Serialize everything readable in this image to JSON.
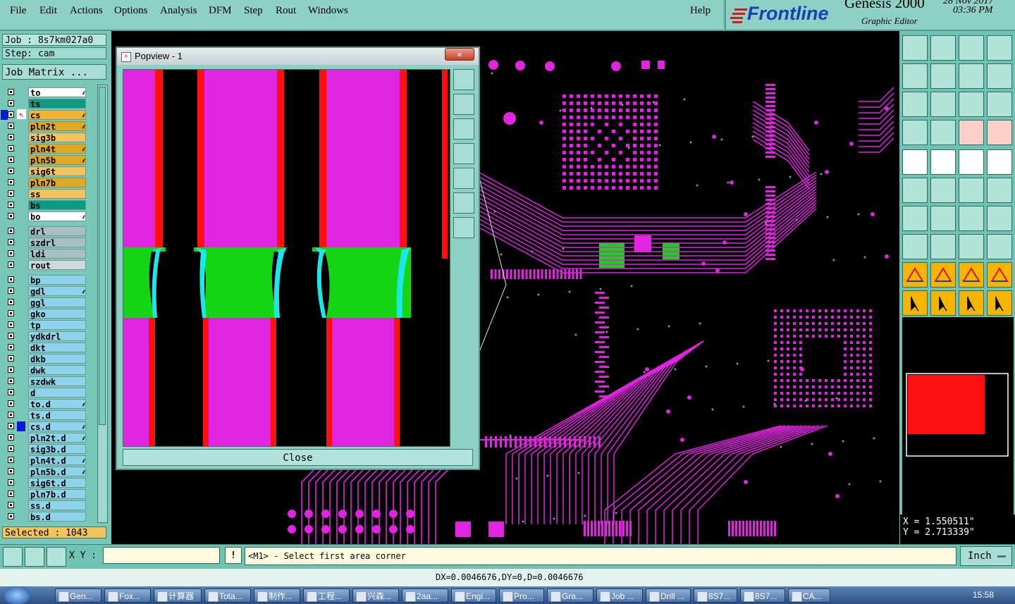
{
  "menubar": {
    "items": [
      "File",
      "Edit",
      "Actions",
      "Options",
      "Analysis",
      "DFM",
      "Step",
      "Rout",
      "Windows"
    ],
    "help": "Help"
  },
  "brand": {
    "logo": "Frontline",
    "product": "Genesis 2000",
    "subtitle": "Graphic Editor",
    "date": "28 Nov 2017",
    "time": "03:36 PM"
  },
  "job": {
    "job_label": "Job : 8s7km027a0",
    "step_label": "Step: cam",
    "matrix_button": "Job Matrix ...",
    "selected": "Selected : 1043"
  },
  "layers": [
    {
      "name": "to",
      "color": "#ffffff",
      "mark": "⸙"
    },
    {
      "name": "ts",
      "color": "#0f9a86",
      "mark": ""
    },
    {
      "name": "cs",
      "color": "#f2b233",
      "mark": "⸙"
    },
    {
      "name": "pln2t",
      "color": "#e3a81e",
      "mark": "⸙"
    },
    {
      "name": "sig3b",
      "color": "#f5c35d",
      "mark": ""
    },
    {
      "name": "pln4t",
      "color": "#e3a81e",
      "mark": "⸙"
    },
    {
      "name": "pln5b",
      "color": "#e3a81e",
      "mark": "⸙"
    },
    {
      "name": "sig6t",
      "color": "#f5c35d",
      "mark": ""
    },
    {
      "name": "pln7b",
      "color": "#e3a81e",
      "mark": ""
    },
    {
      "name": "ss",
      "color": "#f5c35d",
      "mark": ""
    },
    {
      "name": "bs",
      "color": "#0f9a86",
      "mark": ""
    },
    {
      "name": "bo",
      "color": "#ffffff",
      "mark": "⸙"
    },
    {
      "name": "drl",
      "color": "#a8bfc3",
      "mark": ""
    },
    {
      "name": "szdrl",
      "color": "#a8bfc3",
      "mark": ""
    },
    {
      "name": "ldi",
      "color": "#a8bfc3",
      "mark": ""
    },
    {
      "name": "rout",
      "color": "#cfd7d9",
      "mark": ""
    },
    {
      "name": "bp",
      "color": "#8fd3ea",
      "mark": ""
    },
    {
      "name": "gdl",
      "color": "#8fd3ea",
      "mark": "⸙"
    },
    {
      "name": "ggl",
      "color": "#8fd3ea",
      "mark": ""
    },
    {
      "name": "gko",
      "color": "#8fd3ea",
      "mark": ""
    },
    {
      "name": "tp",
      "color": "#8fd3ea",
      "mark": ""
    },
    {
      "name": "ydkdrl",
      "color": "#8fd3ea",
      "mark": ""
    },
    {
      "name": "dkt",
      "color": "#8fd3ea",
      "mark": ""
    },
    {
      "name": "dkb",
      "color": "#8fd3ea",
      "mark": ""
    },
    {
      "name": "dwk",
      "color": "#8fd3ea",
      "mark": ""
    },
    {
      "name": "szdwk",
      "color": "#8fd3ea",
      "mark": ""
    },
    {
      "name": "d",
      "color": "#8fd3ea",
      "mark": ""
    },
    {
      "name": "to.d",
      "color": "#8fd3ea",
      "mark": "⸙"
    },
    {
      "name": "ts.d",
      "color": "#8fd3ea",
      "mark": ""
    },
    {
      "name": "cs.d",
      "color": "#8fd3ea",
      "mark": "⸙"
    },
    {
      "name": "pln2t.d",
      "color": "#8fd3ea",
      "mark": "⸙"
    },
    {
      "name": "sig3b.d",
      "color": "#8fd3ea",
      "mark": ""
    },
    {
      "name": "pln4t.d",
      "color": "#8fd3ea",
      "mark": "⸙"
    },
    {
      "name": "pln5b.d",
      "color": "#8fd3ea",
      "mark": "⸙"
    },
    {
      "name": "sig6t.d",
      "color": "#8fd3ea",
      "mark": ""
    },
    {
      "name": "pln7b.d",
      "color": "#8fd3ea",
      "mark": ""
    },
    {
      "name": "ss.d",
      "color": "#8fd3ea",
      "mark": ""
    },
    {
      "name": "bs.d",
      "color": "#8fd3ea",
      "mark": ""
    }
  ],
  "popview": {
    "title": "Popview - 1",
    "close_label": "Close"
  },
  "coords": {
    "x": "X = 1.550511\"",
    "y": "Y = 2.713339\""
  },
  "command": {
    "xy_label": "X Y :",
    "xy_value": "",
    "prompt": "<M1> - Select first area corner",
    "units": "Inch"
  },
  "status": {
    "measure": "DX=0.0046676,DY=0,D=0.0046676"
  },
  "taskbar": {
    "items": [
      "Gen...",
      "Fox...",
      "计算器",
      "Tota...",
      "制作...",
      "工程...",
      "兴森...",
      "2aa...",
      "Engi...",
      "Pro...",
      "Gra...",
      "Job ...",
      "Drill ...",
      "8S7...",
      "8S7...",
      "CA..."
    ],
    "clock": "15:58"
  },
  "colors": {
    "pad": "#e024e0",
    "green": "#14d414",
    "cyan": "#1de6e6",
    "red": "#ff1010",
    "panel": "#6ec3b4"
  }
}
